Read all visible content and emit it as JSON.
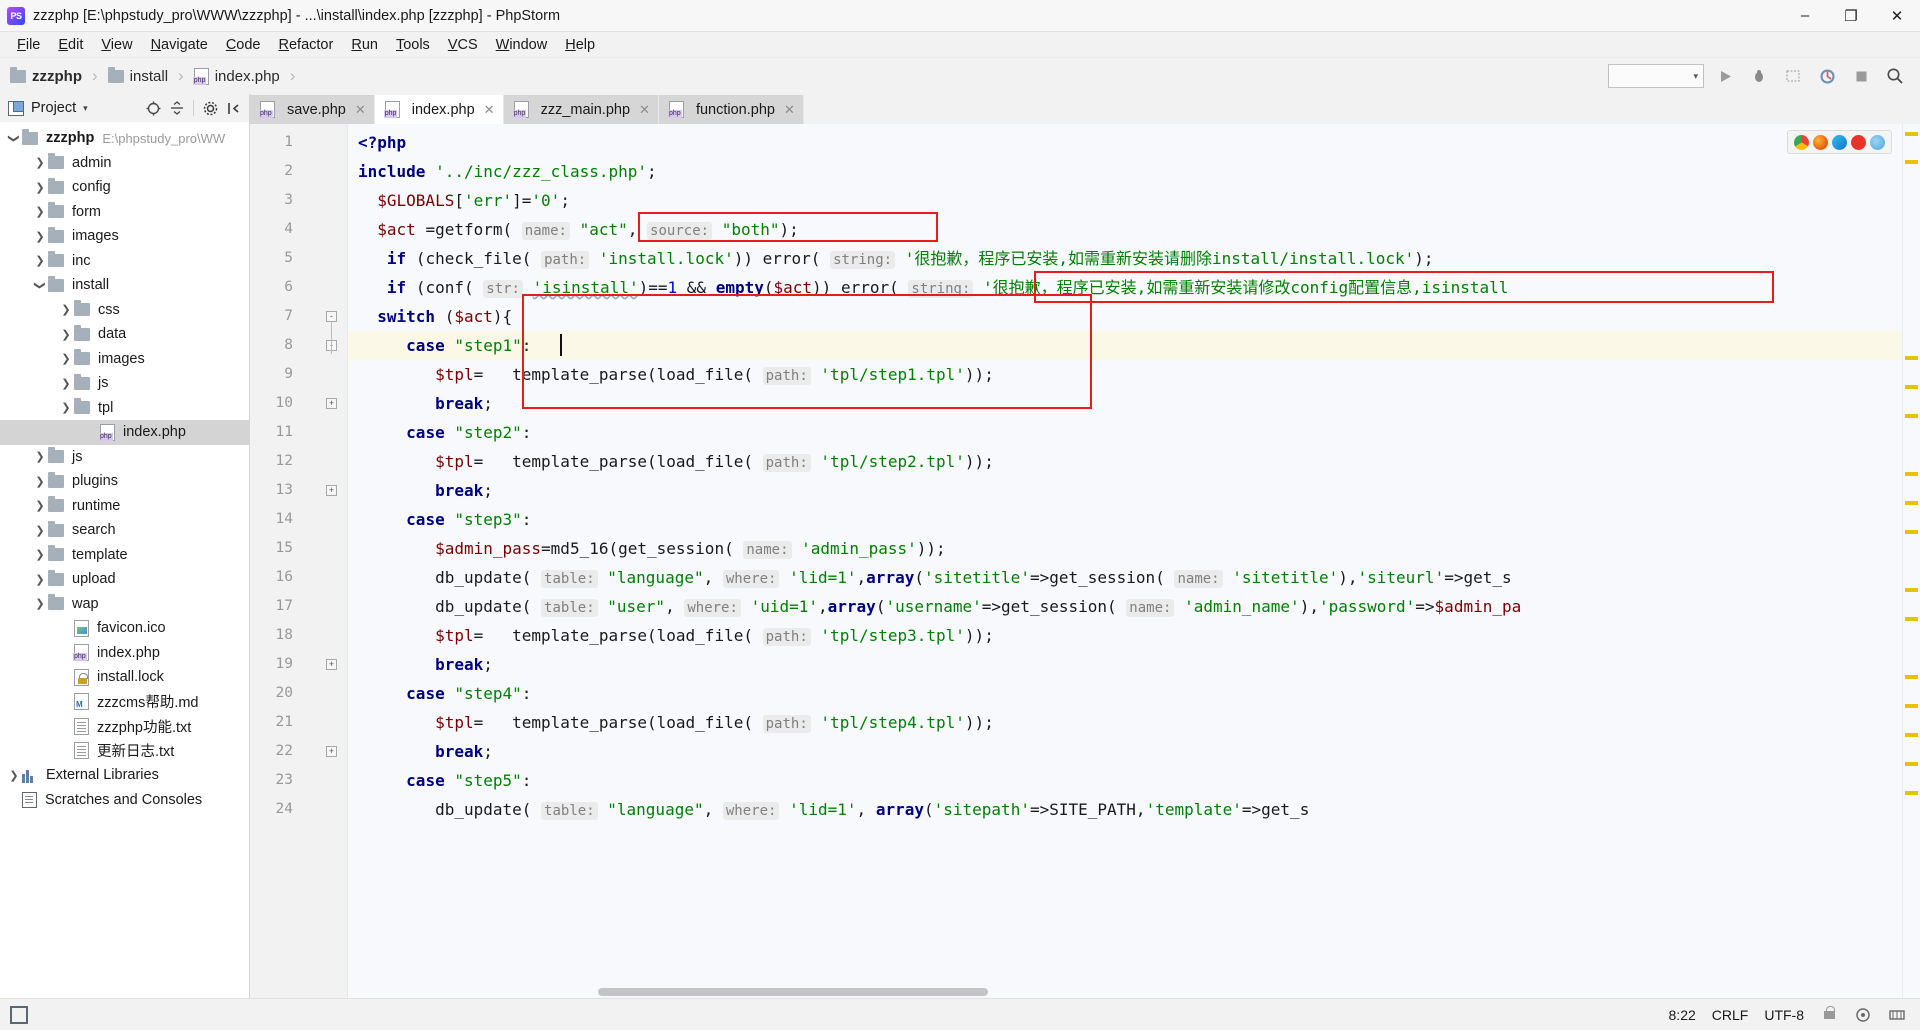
{
  "window": {
    "title": "zzzphp [E:\\phpstudy_pro\\WWW\\zzzphp] - ...\\install\\index.php [zzzphp] - PhpStorm",
    "logo_text": "PS",
    "minimize": "–",
    "maximize": "❐",
    "close": "✕"
  },
  "menu": {
    "items": [
      "File",
      "Edit",
      "View",
      "Navigate",
      "Code",
      "Refactor",
      "Run",
      "Tools",
      "VCS",
      "Window",
      "Help"
    ]
  },
  "breadcrumb": {
    "items": [
      {
        "label": "zzzphp",
        "icon": "folder-icon",
        "bold": true
      },
      {
        "label": "install",
        "icon": "folder-icon",
        "bold": false
      },
      {
        "label": "index.php",
        "icon": "php-file-icon",
        "bold": false
      }
    ],
    "separator": "›"
  },
  "toolbar": {
    "run_config_value": "",
    "run_label": "▶",
    "debug_label": "🐞",
    "coverage_label": "▒",
    "profile_label": "⌘",
    "stop_label": "■",
    "search_label": "🔍"
  },
  "sidebar": {
    "title": "Project",
    "caret": "▾",
    "tools": [
      "target-icon",
      "collapse-icon",
      "gear-icon",
      "hide-icon"
    ],
    "tree": [
      {
        "label": "zzzphp",
        "path": "E:\\phpstudy_pro\\WW",
        "depth": 0,
        "arrow": "⌄",
        "icon": "folder-icon",
        "bold": true,
        "selected": false
      },
      {
        "label": "admin",
        "path": "",
        "depth": 1,
        "arrow": "›",
        "icon": "folder-icon",
        "bold": false,
        "selected": false
      },
      {
        "label": "config",
        "path": "",
        "depth": 1,
        "arrow": "›",
        "icon": "folder-icon",
        "bold": false,
        "selected": false
      },
      {
        "label": "form",
        "path": "",
        "depth": 1,
        "arrow": "›",
        "icon": "folder-icon",
        "bold": false,
        "selected": false
      },
      {
        "label": "images",
        "path": "",
        "depth": 1,
        "arrow": "›",
        "icon": "folder-icon",
        "bold": false,
        "selected": false
      },
      {
        "label": "inc",
        "path": "",
        "depth": 1,
        "arrow": "›",
        "icon": "folder-icon",
        "bold": false,
        "selected": false
      },
      {
        "label": "install",
        "path": "",
        "depth": 1,
        "arrow": "⌄",
        "icon": "folder-icon",
        "bold": false,
        "selected": false
      },
      {
        "label": "css",
        "path": "",
        "depth": 2,
        "arrow": "›",
        "icon": "folder-icon",
        "bold": false,
        "selected": false
      },
      {
        "label": "data",
        "path": "",
        "depth": 2,
        "arrow": "›",
        "icon": "folder-icon",
        "bold": false,
        "selected": false
      },
      {
        "label": "images",
        "path": "",
        "depth": 2,
        "arrow": "›",
        "icon": "folder-icon",
        "bold": false,
        "selected": false
      },
      {
        "label": "js",
        "path": "",
        "depth": 2,
        "arrow": "›",
        "icon": "folder-icon",
        "bold": false,
        "selected": false
      },
      {
        "label": "tpl",
        "path": "",
        "depth": 2,
        "arrow": "›",
        "icon": "folder-icon",
        "bold": false,
        "selected": false
      },
      {
        "label": "index.php",
        "path": "",
        "depth": 3,
        "arrow": "",
        "icon": "php-file-icon",
        "bold": false,
        "selected": true
      },
      {
        "label": "js",
        "path": "",
        "depth": 1,
        "arrow": "›",
        "icon": "folder-icon",
        "bold": false,
        "selected": false
      },
      {
        "label": "plugins",
        "path": "",
        "depth": 1,
        "arrow": "›",
        "icon": "folder-icon",
        "bold": false,
        "selected": false
      },
      {
        "label": "runtime",
        "path": "",
        "depth": 1,
        "arrow": "›",
        "icon": "folder-icon",
        "bold": false,
        "selected": false
      },
      {
        "label": "search",
        "path": "",
        "depth": 1,
        "arrow": "›",
        "icon": "folder-icon",
        "bold": false,
        "selected": false
      },
      {
        "label": "template",
        "path": "",
        "depth": 1,
        "arrow": "›",
        "icon": "folder-icon",
        "bold": false,
        "selected": false
      },
      {
        "label": "upload",
        "path": "",
        "depth": 1,
        "arrow": "›",
        "icon": "folder-icon",
        "bold": false,
        "selected": false
      },
      {
        "label": "wap",
        "path": "",
        "depth": 1,
        "arrow": "›",
        "icon": "folder-icon",
        "bold": false,
        "selected": false
      },
      {
        "label": "favicon.ico",
        "path": "",
        "depth": 2,
        "arrow": "",
        "icon": "image-file-icon",
        "bold": false,
        "selected": false
      },
      {
        "label": "index.php",
        "path": "",
        "depth": 2,
        "arrow": "",
        "icon": "php-file-icon",
        "bold": false,
        "selected": false
      },
      {
        "label": "install.lock",
        "path": "",
        "depth": 2,
        "arrow": "",
        "icon": "lock-file-icon",
        "bold": false,
        "selected": false
      },
      {
        "label": "zzzcms帮助.md",
        "path": "",
        "depth": 2,
        "arrow": "",
        "icon": "markdown-file-icon",
        "bold": false,
        "selected": false
      },
      {
        "label": "zzzphp功能.txt",
        "path": "",
        "depth": 2,
        "arrow": "",
        "icon": "text-file-icon",
        "bold": false,
        "selected": false
      },
      {
        "label": "更新日志.txt",
        "path": "",
        "depth": 2,
        "arrow": "",
        "icon": "text-file-icon",
        "bold": false,
        "selected": false
      },
      {
        "label": "External Libraries",
        "path": "",
        "depth": 0,
        "arrow": "›",
        "icon": "library-icon",
        "bold": false,
        "selected": false
      },
      {
        "label": "Scratches and Consoles",
        "path": "",
        "depth": 0,
        "arrow": "",
        "icon": "scratch-icon",
        "bold": false,
        "selected": false
      }
    ]
  },
  "editor": {
    "tabs": [
      {
        "label": "save.php",
        "active": false
      },
      {
        "label": "index.php",
        "active": true
      },
      {
        "label": "zzz_main.php",
        "active": false
      },
      {
        "label": "function.php",
        "active": false
      }
    ],
    "tab_close": "✕",
    "line_numbers": [
      1,
      2,
      3,
      4,
      5,
      6,
      7,
      8,
      9,
      10,
      11,
      12,
      13,
      14,
      15,
      16,
      17,
      18,
      19,
      20,
      21,
      22,
      23,
      24
    ],
    "highlighted_line": 8,
    "lines": [
      {
        "n": 1,
        "html": "<span class='kw'>&lt;?php</span>"
      },
      {
        "n": 2,
        "html": "<span class='kw'>include</span> <span class='str'>'../inc/zzz_class.php'</span><span class='pl'>;</span>"
      },
      {
        "n": 3,
        "html": "  <span class='var'>$GLOBALS</span><span class='pl'>[</span><span class='str'>'err'</span><span class='pl'>]=</span><span class='str'>'0'</span><span class='pl'>;</span>"
      },
      {
        "n": 4,
        "html": "  <span class='var'>$act</span> <span class='pl'>=</span><span class='fn'>getform</span><span class='pl'>(</span> <span class='hint'>name:</span> <span class='str'>\"act\"</span><span class='pl'>,</span> <span class='hint'>source:</span> <span class='str'>\"both\"</span><span class='pl'>);</span>"
      },
      {
        "n": 5,
        "html": "   <span class='kw'>if</span> <span class='pl'>(</span><span class='fn'>check_file</span><span class='pl'>(</span> <span class='hint'>path:</span> <span class='str'>'install.lock'</span><span class='pl'>))</span> <span class='fn'>error</span><span class='pl'>(</span> <span class='hint'>string:</span> <span class='str'>'很抱歉，程序已安装,如需重新安装请删除install/install.lock'</span><span class='pl'>);</span>"
      },
      {
        "n": 6,
        "html": "   <span class='kw'>if</span> <span class='pl'>(</span><span class='fn'>conf</span><span class='pl'>(</span> <span class='hint'>str:</span> <span class='str wavy'>'isinstall'</span><span class='pl'>)==</span><span class='num'>1</span> <span class='pl'>&amp;&amp;</span> <span class='kw'>empty</span><span class='pl'>(</span><span class='var'>$act</span><span class='pl'>))</span> <span class='fn'>error</span><span class='pl'>(</span> <span class='hint'>string:</span> <span class='str'>'很抱歉，程序已安装,如需重新安装请修改config配置信息,isinstall</span>"
      },
      {
        "n": 7,
        "html": "  <span class='kw'>switch</span> <span class='pl'>(</span><span class='var'>$act</span><span class='pl'>){</span>"
      },
      {
        "n": 8,
        "html": "     <span class='kw'>case</span> <span class='str'>\"step1\"</span><span class='pl'>:</span>"
      },
      {
        "n": 9,
        "html": "        <span class='var'>$tpl</span><span class='pl'>=</span>   <span class='fn'>template_parse</span><span class='pl'>(</span><span class='fn'>load_file</span><span class='pl'>(</span> <span class='hint'>path:</span> <span class='str'>'tpl/step1.tpl'</span><span class='pl'>));</span>"
      },
      {
        "n": 10,
        "html": "        <span class='kw'>break</span><span class='pl'>;</span>"
      },
      {
        "n": 11,
        "html": "     <span class='kw'>case</span> <span class='str'>\"step2\"</span><span class='pl'>:</span>"
      },
      {
        "n": 12,
        "html": "        <span class='var'>$tpl</span><span class='pl'>=</span>   <span class='fn'>template_parse</span><span class='pl'>(</span><span class='fn'>load_file</span><span class='pl'>(</span> <span class='hint'>path:</span> <span class='str'>'tpl/step2.tpl'</span><span class='pl'>));</span>"
      },
      {
        "n": 13,
        "html": "        <span class='kw'>break</span><span class='pl'>;</span>"
      },
      {
        "n": 14,
        "html": "     <span class='kw'>case</span> <span class='str'>\"step3\"</span><span class='pl'>:</span>"
      },
      {
        "n": 15,
        "html": "        <span class='var'>$admin_pass</span><span class='pl'>=</span><span class='fn'>md5_16</span><span class='pl'>(</span><span class='fn'>get_session</span><span class='pl'>(</span> <span class='hint'>name:</span> <span class='str'>'admin_pass'</span><span class='pl'>));</span>"
      },
      {
        "n": 16,
        "html": "        <span class='fn'>db_update</span><span class='pl'>(</span> <span class='hint'>table:</span> <span class='str'>\"language\"</span><span class='pl'>,</span> <span class='hint'>where:</span> <span class='str'>'lid=1'</span><span class='pl'>,</span><span class='kw'>array</span><span class='pl'>(</span><span class='str'>'sitetitle'</span><span class='pl'>=&gt;</span><span class='fn'>get_session</span><span class='pl'>(</span> <span class='hint'>name:</span> <span class='str'>'sitetitle'</span><span class='pl'>),</span><span class='str'>'siteurl'</span><span class='pl'>=&gt;</span><span class='fn'>get_s</span>"
      },
      {
        "n": 17,
        "html": "        <span class='fn'>db_update</span><span class='pl'>(</span> <span class='hint'>table:</span> <span class='str'>\"user\"</span><span class='pl'>,</span> <span class='hint'>where:</span> <span class='str'>'uid=1'</span><span class='pl'>,</span><span class='kw'>array</span><span class='pl'>(</span><span class='str'>'username'</span><span class='pl'>=&gt;</span><span class='fn'>get_session</span><span class='pl'>(</span> <span class='hint'>name:</span> <span class='str'>'admin_name'</span><span class='pl'>),</span><span class='str'>'password'</span><span class='pl'>=&gt;</span><span class='var'>$admin_pa</span>"
      },
      {
        "n": 18,
        "html": "        <span class='var'>$tpl</span><span class='pl'>=</span>   <span class='fn'>template_parse</span><span class='pl'>(</span><span class='fn'>load_file</span><span class='pl'>(</span> <span class='hint'>path:</span> <span class='str'>'tpl/step3.tpl'</span><span class='pl'>));</span>"
      },
      {
        "n": 19,
        "html": "        <span class='kw'>break</span><span class='pl'>;</span>"
      },
      {
        "n": 20,
        "html": "     <span class='kw'>case</span> <span class='str'>\"step4\"</span><span class='pl'>:</span>"
      },
      {
        "n": 21,
        "html": "        <span class='var'>$tpl</span><span class='pl'>=</span>   <span class='fn'>template_parse</span><span class='pl'>(</span><span class='fn'>load_file</span><span class='pl'>(</span> <span class='hint'>path:</span> <span class='str'>'tpl/step4.tpl'</span><span class='pl'>));</span>"
      },
      {
        "n": 22,
        "html": "        <span class='kw'>break</span><span class='pl'>;</span>"
      },
      {
        "n": 23,
        "html": "     <span class='kw'>case</span> <span class='str'>\"step5\"</span><span class='pl'>:</span>"
      },
      {
        "n": 24,
        "html": "        <span class='fn'>db_update</span><span class='pl'>(</span> <span class='hint'>table:</span> <span class='str'>\"language\"</span><span class='pl'>,</span> <span class='hint'>where:</span> <span class='str'>'lid=1'</span><span class='pl'>,</span> <span class='kw'>array</span><span class='pl'>(</span><span class='str'>'sitepath'</span><span class='pl'>=&gt;</span><span class='fn'>SITE_PATH</span><span class='pl'>,</span><span class='str'>'template'</span><span class='pl'>=&gt;</span><span class='fn'>get_s</span>"
      }
    ],
    "annotations": [
      {
        "name": "redbox-getform-args"
      },
      {
        "name": "redbox-error-string"
      },
      {
        "name": "redbox-switch-step1"
      }
    ],
    "inspection_widget": {
      "icons": [
        "chrome-browser-icon",
        "firefox-browser-icon",
        "edge-browser-icon",
        "opera-browser-icon",
        "safari-browser-icon"
      ]
    }
  },
  "statusbar": {
    "caret_position": "8:22",
    "line_separator": "CRLF",
    "encoding": "UTF-8",
    "lock_icon": "lock-icon",
    "event_icon": "event-log-icon",
    "memory_icon": "memory-icon"
  }
}
